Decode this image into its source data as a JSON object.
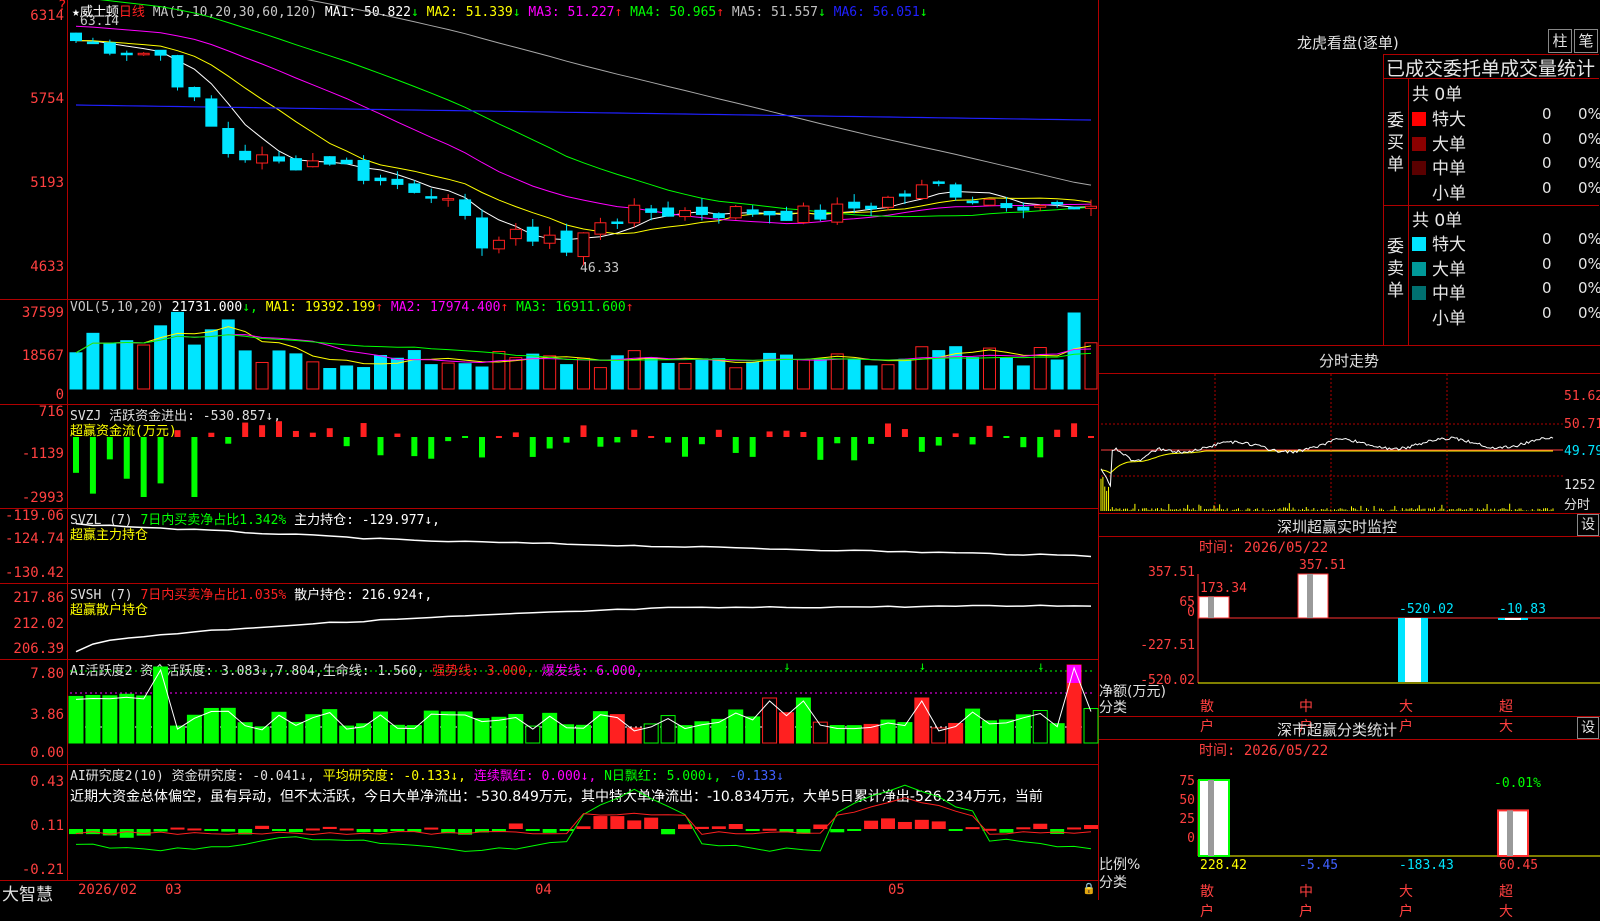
{
  "stock_name": "威士顿",
  "period": "日线",
  "brand": "大智慧",
  "main_chart": {
    "ma_header": "MA(5,10,20,30,60,120)",
    "ma": [
      {
        "label": "MA1: 50.822",
        "arrow": "↓",
        "color": "#ffffff"
      },
      {
        "label": "MA2: 51.339",
        "arrow": "↓",
        "color": "#ffff00"
      },
      {
        "label": "MA3: 51.227",
        "arrow": "↑",
        "color": "#ff00ff"
      },
      {
        "label": "MA4: 50.965",
        "arrow": "↑",
        "color": "#00ff00"
      },
      {
        "label": "MA5: 51.557",
        "arrow": "↓",
        "color": "#c0c0c0"
      },
      {
        "label": "MA6: 56.051",
        "arrow": "↓",
        "color": "#2020ff"
      }
    ],
    "y_labels": [
      "6314",
      "5754",
      "5193",
      "4633"
    ],
    "high_label": "63.14",
    "low_label": "46.33"
  },
  "vol": {
    "title": "VOL(5,10,20)",
    "value": "21731.000",
    "ma": [
      {
        "label": "MA1: 19392.199",
        "arrow": "↑",
        "color": "#ffff00"
      },
      {
        "label": "MA2: 17974.400",
        "arrow": "↑",
        "color": "#ff00ff"
      },
      {
        "label": "MA3: 16911.600",
        "arrow": "↑",
        "color": "#00ff00"
      }
    ],
    "y_labels": [
      "37599",
      "18567",
      "0"
    ]
  },
  "svzj": {
    "title": "SVZJ  活跃资金进出: -530.857↓,",
    "subtitle": "超赢资金流(万元)",
    "y_labels": [
      "716",
      "-1139",
      "-2993"
    ]
  },
  "svzl": {
    "title": "SVZL (7)",
    "ratio": "7日内买卖净占比1.342%",
    "hold": "主力持仓: -129.977↓,",
    "subtitle": "超赢主力持仓",
    "y_labels": [
      "-119.06",
      "-124.74",
      "-130.42"
    ]
  },
  "svsh": {
    "title": "SVSH (7)",
    "ratio": "7日内买卖净占比1.035%",
    "hold": "散户持仓: 216.924↑,",
    "subtitle": "超赢散户持仓",
    "y_labels": [
      "217.86",
      "212.02",
      "206.39"
    ]
  },
  "ai_active": {
    "title": "AI活跃度2 资金活跃度: 3.083↓,7.804,生命线: 1.560,",
    "strong": "强势线: 3.000,",
    "burst": "爆发线: 6.000,",
    "y_labels": [
      "7.80",
      "3.86",
      "0.00"
    ]
  },
  "ai_research": {
    "title": "AI研究度2(10) 资金研究度: -0.041↓,",
    "avg": "平均研究度: -0.133↓,",
    "red": "连续飘红: 0.000↓,",
    "nred": "N日飘红: 5.000↓,",
    "last": "-0.133↓",
    "text": "近期大资金总体偏空，虽有异动，但不太活跃，今日大单净流出：-530.849万元，其中特大单净流出：-10.834万元，大单5日累计净出-526.234万元，当前",
    "y_labels": [
      "0.43",
      "0.11",
      "-0.21"
    ]
  },
  "x_labels": [
    "2026/02",
    "03",
    "04",
    "05"
  ],
  "dragon_tiger": {
    "title": "龙虎看盘(逐单)",
    "btn1": "柱",
    "btn2": "笔",
    "subtitle": "已成交委托单成交量统计",
    "buy_side": "委买单",
    "sell_side": "委卖单",
    "buy_total": "共 0单",
    "sell_total": "共 0单",
    "buy_rows": [
      {
        "name": "特大",
        "count": "0",
        "pct": "0%",
        "color": "#ff0000"
      },
      {
        "name": "大单",
        "count": "0",
        "pct": "0%",
        "color": "#8b0000"
      },
      {
        "name": "中单",
        "count": "0",
        "pct": "0%",
        "color": "#5a0000"
      },
      {
        "name": "小单",
        "count": "0",
        "pct": "0%",
        "color": ""
      }
    ],
    "sell_rows": [
      {
        "name": "特大",
        "count": "0",
        "pct": "0%",
        "color": "#00e5ff"
      },
      {
        "name": "大单",
        "count": "0",
        "pct": "0%",
        "color": "#009999"
      },
      {
        "name": "中单",
        "count": "0",
        "pct": "0%",
        "color": "#007070"
      },
      {
        "name": "小单",
        "count": "0",
        "pct": "0%",
        "color": ""
      }
    ]
  },
  "intraday": {
    "title": "分时走势",
    "y_labels": [
      "51.62",
      "50.71",
      "49.79"
    ],
    "vol_label": "1252",
    "unit": "分时"
  },
  "sz_monitor": {
    "title": "深圳超赢实时监控",
    "btn": "设",
    "time": "时间: 2026/05/22",
    "y_labels": [
      "357.51",
      "65",
      "0",
      "-227.51",
      "-520.02"
    ],
    "bars": [
      {
        "name": "散户",
        "value": 173.34,
        "label": "173.34"
      },
      {
        "name": "中户",
        "value": 357.51,
        "label": "357.51"
      },
      {
        "name": "大户",
        "value": -520.02,
        "label": "-520.02"
      },
      {
        "name": "超大",
        "value": -10.83,
        "label": "-10.83"
      }
    ],
    "axis_title": "净额(万元)",
    "cat_title": "分类"
  },
  "sz_category": {
    "title": "深市超赢分类统计",
    "btn": "设",
    "time": "时间: 2026/05/22",
    "y_labels": [
      "75",
      "50",
      "25",
      "0"
    ],
    "top_label": "-0.01%",
    "bars": [
      {
        "name": "散户",
        "ratio": 100,
        "value": "228.42"
      },
      {
        "name": "中户",
        "ratio": 0,
        "value": "-5.45"
      },
      {
        "name": "大户",
        "ratio": 0,
        "value": "-183.43"
      },
      {
        "name": "超大",
        "ratio": 60,
        "value": "60.45"
      }
    ],
    "axis_title": "比例%",
    "cat_title": "分类"
  }
}
